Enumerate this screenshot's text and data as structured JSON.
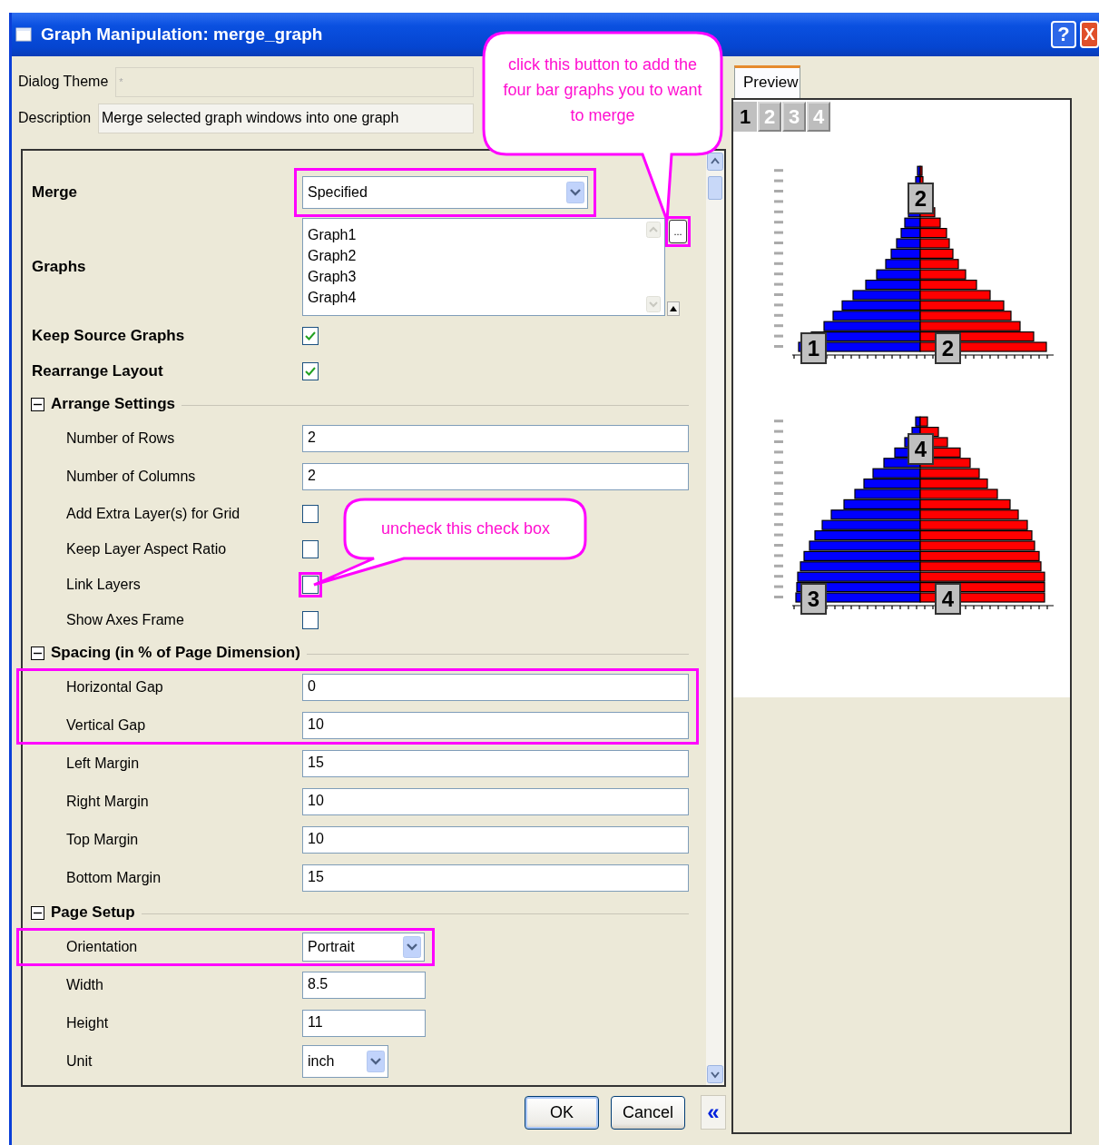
{
  "window": {
    "title": "Graph Manipulation: merge_graph",
    "help_button": "?",
    "close_button": "X"
  },
  "header": [
    {
      "kind": "theme",
      "label": "Dialog Theme",
      "placeholder": "*"
    },
    {
      "kind": "description",
      "label": "Description",
      "value": "Merge selected graph windows into one graph"
    }
  ],
  "settings": [
    {
      "kind": "dropdown",
      "label": "Merge",
      "value": "Specified",
      "highlighted": true
    },
    {
      "kind": "list",
      "label": "Graphs",
      "items": [
        "Graph1",
        "Graph2",
        "Graph3",
        "Graph4"
      ],
      "browse_button": {
        "label": "...",
        "highlighted": true
      }
    },
    {
      "kind": "checkbox",
      "label": "Keep Source Graphs",
      "checked": true,
      "highlighted": false
    },
    {
      "kind": "checkbox",
      "label": "Rearrange Layout",
      "checked": true,
      "highlighted": false
    },
    {
      "kind": "section",
      "label": "Arrange Settings",
      "expanded": true,
      "children": [
        {
          "kind": "field",
          "label": "Number of Rows",
          "value": "2",
          "highlighted": false
        },
        {
          "kind": "field",
          "label": "Number of Columns",
          "value": "2",
          "highlighted": false
        },
        {
          "kind": "checkbox",
          "label": "Add Extra Layer(s) for Grid",
          "checked": false,
          "highlighted": false
        },
        {
          "kind": "checkbox",
          "label": "Keep Layer Aspect Ratio",
          "checked": false,
          "highlighted": false
        },
        {
          "kind": "checkbox",
          "label": "Link Layers",
          "checked": false,
          "highlighted": true
        },
        {
          "kind": "checkbox",
          "label": "Show Axes Frame",
          "checked": false,
          "highlighted": false
        }
      ]
    },
    {
      "kind": "section",
      "label": "Spacing (in % of Page Dimension)",
      "expanded": true,
      "children": [
        {
          "kind": "field",
          "label": "Horizontal Gap",
          "value": "0",
          "highlighted": true
        },
        {
          "kind": "field",
          "label": "Vertical Gap",
          "value": "10",
          "highlighted": true
        },
        {
          "kind": "field",
          "label": "Left Margin",
          "value": "15",
          "highlighted": false
        },
        {
          "kind": "field",
          "label": "Right Margin",
          "value": "10",
          "highlighted": false
        },
        {
          "kind": "field",
          "label": "Top Margin",
          "value": "10",
          "highlighted": false
        },
        {
          "kind": "field",
          "label": "Bottom Margin",
          "value": "15",
          "highlighted": false
        }
      ]
    },
    {
      "kind": "section",
      "label": "Page Setup",
      "expanded": true,
      "children": [
        {
          "kind": "short-dropdown",
          "label": "Orientation",
          "value": "Portrait",
          "highlighted": true
        },
        {
          "kind": "short-field",
          "label": "Width",
          "value": "8.5",
          "highlighted": false
        },
        {
          "kind": "short-field",
          "label": "Height",
          "value": "11",
          "highlighted": false
        },
        {
          "kind": "tiny-dropdown",
          "label": "Unit",
          "value": "inch",
          "highlighted": false
        }
      ]
    }
  ],
  "buttons": [
    {
      "label": "OK",
      "default": true
    },
    {
      "label": "Cancel",
      "default": false
    }
  ],
  "collapse_button": "«",
  "preview": {
    "tab": "Preview",
    "pages": [
      {
        "label": "1",
        "selected": true
      },
      {
        "label": "2",
        "selected": false
      },
      {
        "label": "3",
        "selected": false
      },
      {
        "label": "4",
        "selected": false
      }
    ],
    "graphs": [
      {
        "badges": [
          "2",
          "1",
          "2"
        ]
      },
      {
        "badges": [
          "4",
          "3",
          "4"
        ]
      }
    ]
  },
  "callouts": [
    {
      "text": "click this button to add the four bar graphs you to want to merge"
    },
    {
      "text": "uncheck this check box"
    }
  ]
}
